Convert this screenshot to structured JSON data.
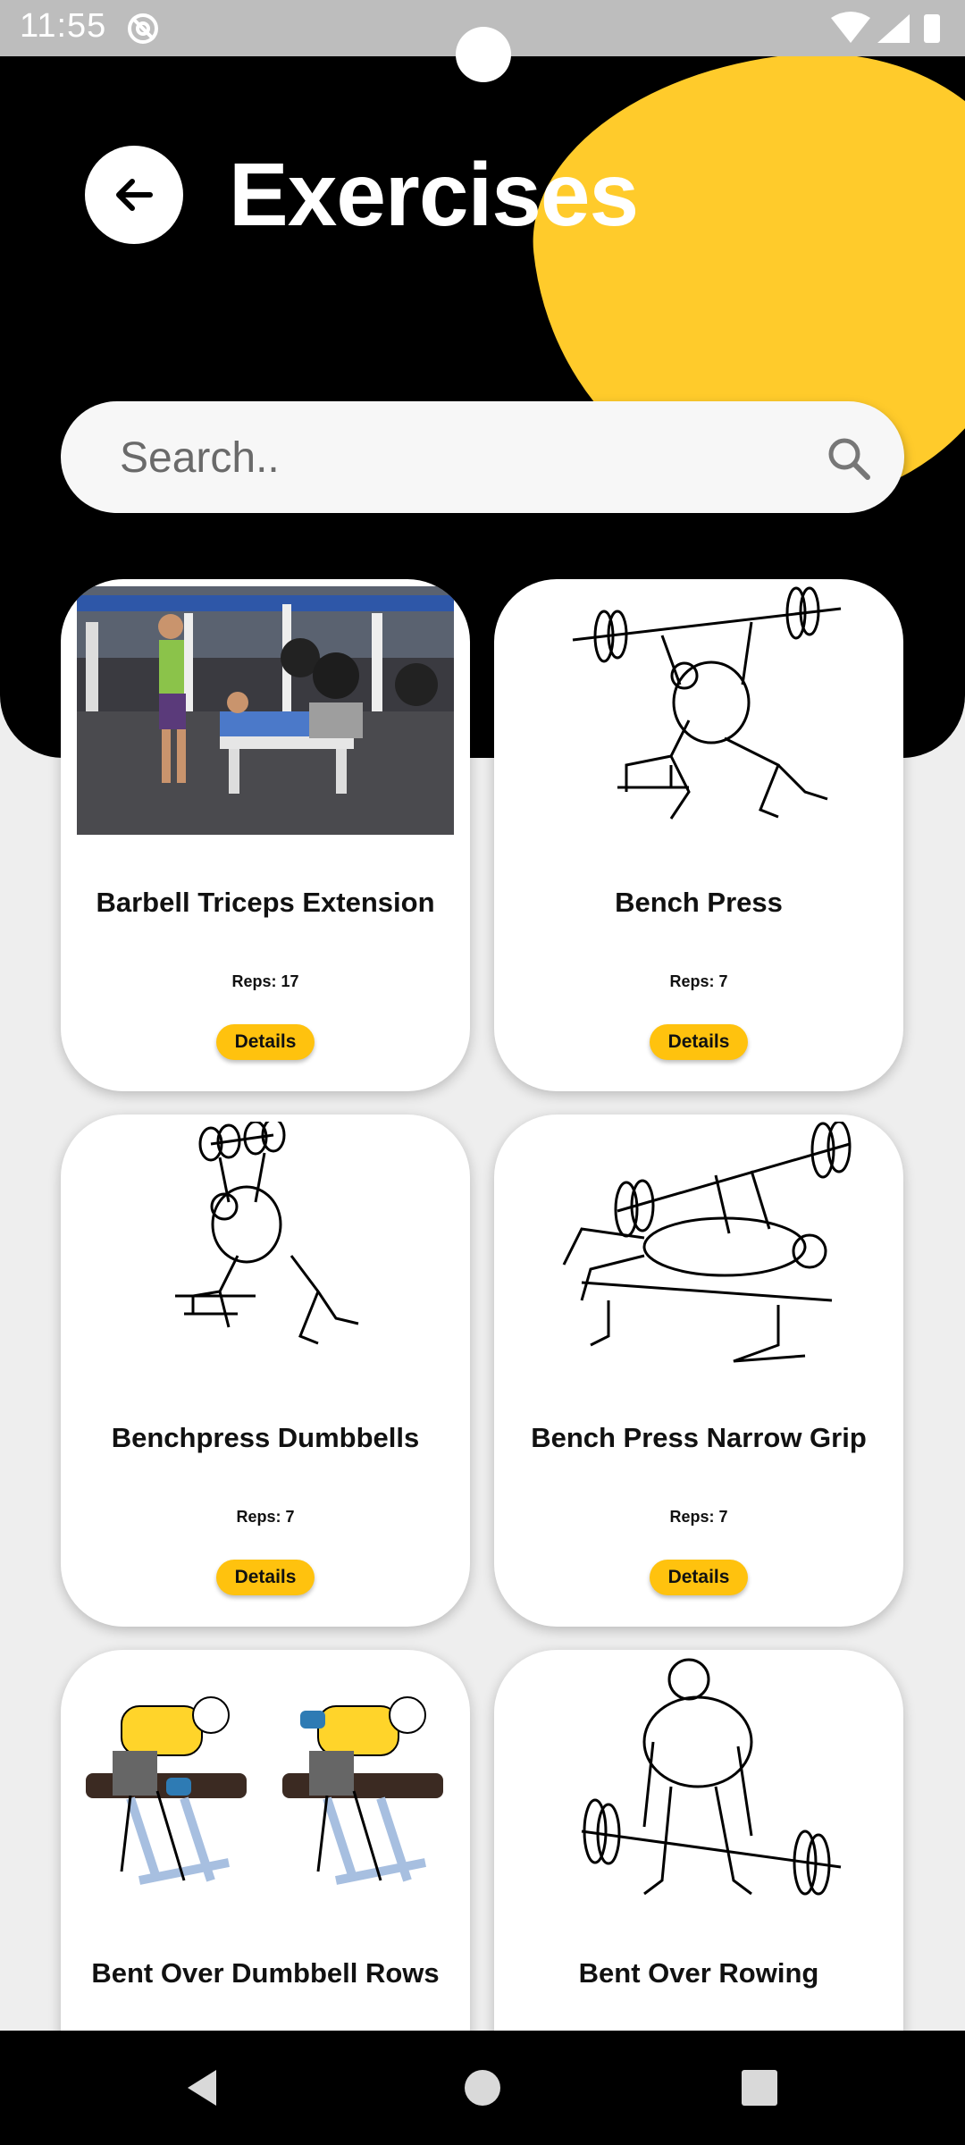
{
  "status_bar": {
    "time": "11:55"
  },
  "header": {
    "title": "Exercises"
  },
  "search": {
    "placeholder": "Search.."
  },
  "cards": [
    {
      "title": "Barbell Triceps Extension",
      "reps": "Reps: 17",
      "details": "Details"
    },
    {
      "title": "Bench Press",
      "reps": "Reps: 7",
      "details": "Details"
    },
    {
      "title": "Benchpress Dumbbells",
      "reps": "Reps: 7",
      "details": "Details"
    },
    {
      "title": "Bench Press Narrow Grip",
      "reps": "Reps: 7",
      "details": "Details"
    },
    {
      "title": "Bent Over Dumbbell Rows"
    },
    {
      "title": "Bent Over Rowing"
    }
  ],
  "colors": {
    "accent": "#ffcb2b",
    "button": "#ffc20e",
    "header_bg": "#000000",
    "page_bg": "#eeeeee"
  },
  "icons": [
    "back-arrow-icon",
    "search-icon",
    "nav-back-icon",
    "nav-home-icon",
    "nav-recent-icon"
  ]
}
